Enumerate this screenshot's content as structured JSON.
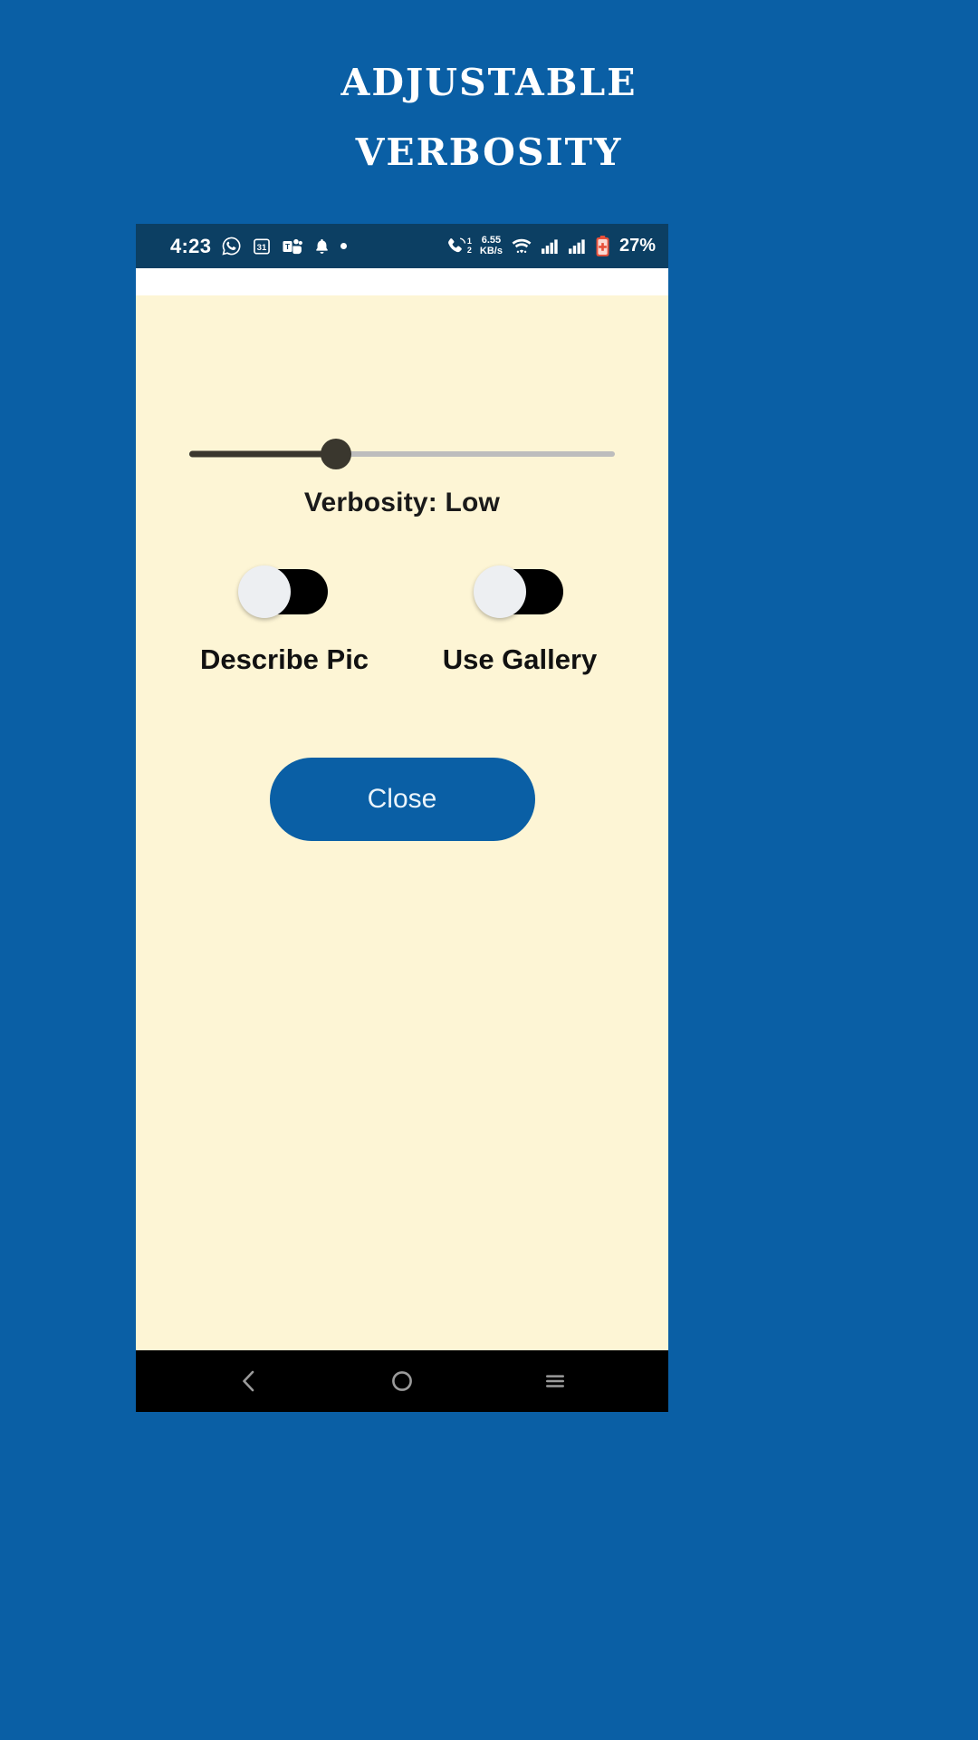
{
  "heading": {
    "line1": "Adjustable",
    "line2": "Verbosity"
  },
  "colors": {
    "page_background": "#0A5FA5",
    "app_background": "#FDF5D5",
    "status_bar": "#0C3F63",
    "accent_button": "#0A5FA5",
    "slider_active": "#3A372E",
    "slider_inactive": "#BDBDBD",
    "switch_track": "#000000",
    "switch_thumb": "#EDEFF2",
    "nav_bar": "#000000",
    "battery": "#E8503A"
  },
  "status_bar": {
    "clock": "4:23",
    "left_icons": [
      {
        "name": "whatsapp-icon",
        "label": "WhatsApp"
      },
      {
        "name": "calendar-icon",
        "label": "31"
      },
      {
        "name": "microsoft-teams-icon",
        "label": "Teams"
      },
      {
        "name": "bell-icon",
        "label": "Notification"
      },
      {
        "name": "dot-icon",
        "label": "More"
      }
    ],
    "call_sim_icon": "dual-sim-call-icon",
    "sim_1": "1",
    "sim_2": "2",
    "net_speed_value": "6.55",
    "net_speed_unit": "KB/s",
    "wifi_icon": "wifi-icon",
    "signal_1_icon": "signal-bars-icon",
    "signal_2_icon": "signal-bars-icon",
    "battery_icon": "battery-saver-icon",
    "battery_percent": "27%"
  },
  "app": {
    "slider": {
      "name": "verbosity-slider",
      "value_percent": 34.5,
      "min": 0,
      "max": 100
    },
    "verbosity_label": "Verbosity: Low",
    "toggles": [
      {
        "name": "describe-pic-toggle",
        "label": "Describe Pic",
        "state": "off"
      },
      {
        "name": "use-gallery-toggle",
        "label": "Use Gallery",
        "state": "off"
      }
    ],
    "close_button_label": "Close"
  },
  "nav_bar": {
    "back_icon": "back-chevron-icon",
    "home_icon": "home-circle-icon",
    "recents_icon": "hamburger-recents-icon"
  }
}
